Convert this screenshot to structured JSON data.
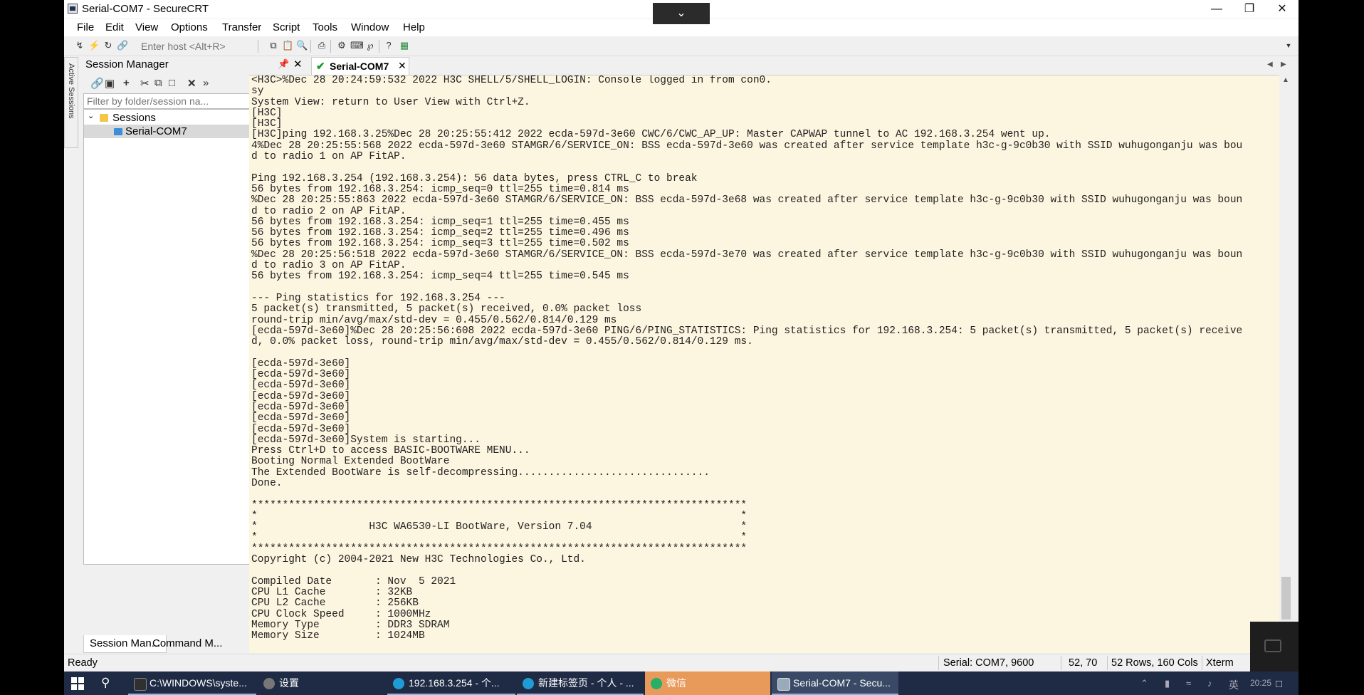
{
  "window": {
    "title": "Serial-COM7 - SecureCRT"
  },
  "menubar": [
    "File",
    "Edit",
    "View",
    "Options",
    "Transfer",
    "Script",
    "Tools",
    "Window",
    "Help"
  ],
  "toolbar": {
    "host_placeholder": "Enter host <Alt+R>"
  },
  "sidebar_tab": "Active Sessions",
  "session_manager": {
    "title": "Session Manager",
    "filter_placeholder": "Filter by folder/session na...",
    "tree": [
      {
        "label": "Sessions",
        "type": "folder",
        "expanded": true
      },
      {
        "label": "Serial-COM7",
        "type": "session",
        "selected": true
      }
    ],
    "bottom_tabs": [
      "Session Man...",
      "Command M..."
    ]
  },
  "session_tab": {
    "label": "Serial-COM7",
    "status": "connected"
  },
  "terminal_text": "<H3C>%Dec 28 20:24:59:532 2022 H3C SHELL/5/SHELL_LOGIN: Console logged in from con0.\nsy\nSystem View: return to User View with Ctrl+Z.\n[H3C]\n[H3C]\n[H3C]ping 192.168.3.25%Dec 28 20:25:55:412 2022 ecda-597d-3e60 CWC/6/CWC_AP_UP: Master CAPWAP tunnel to AC 192.168.3.254 went up.\n4%Dec 28 20:25:55:568 2022 ecda-597d-3e60 STAMGR/6/SERVICE_ON: BSS ecda-597d-3e60 was created after service template h3c-g-9c0b30 with SSID wuhugonganju was bou\nd to radio 1 on AP FitAP.\n\nPing 192.168.3.254 (192.168.3.254): 56 data bytes, press CTRL_C to break\n56 bytes from 192.168.3.254: icmp_seq=0 ttl=255 time=0.814 ms\n%Dec 28 20:25:55:863 2022 ecda-597d-3e60 STAMGR/6/SERVICE_ON: BSS ecda-597d-3e68 was created after service template h3c-g-9c0b30 with SSID wuhugonganju was boun\nd to radio 2 on AP FitAP.\n56 bytes from 192.168.3.254: icmp_seq=1 ttl=255 time=0.455 ms\n56 bytes from 192.168.3.254: icmp_seq=2 ttl=255 time=0.496 ms\n56 bytes from 192.168.3.254: icmp_seq=3 ttl=255 time=0.502 ms\n%Dec 28 20:25:56:518 2022 ecda-597d-3e60 STAMGR/6/SERVICE_ON: BSS ecda-597d-3e70 was created after service template h3c-g-9c0b30 with SSID wuhugonganju was boun\nd to radio 3 on AP FitAP.\n56 bytes from 192.168.3.254: icmp_seq=4 ttl=255 time=0.545 ms\n\n--- Ping statistics for 192.168.3.254 ---\n5 packet(s) transmitted, 5 packet(s) received, 0.0% packet loss\nround-trip min/avg/max/std-dev = 0.455/0.562/0.814/0.129 ms\n[ecda-597d-3e60]%Dec 28 20:25:56:608 2022 ecda-597d-3e60 PING/6/PING_STATISTICS: Ping statistics for 192.168.3.254: 5 packet(s) transmitted, 5 packet(s) receive\nd, 0.0% packet loss, round-trip min/avg/max/std-dev = 0.455/0.562/0.814/0.129 ms.\n\n[ecda-597d-3e60]\n[ecda-597d-3e60]\n[ecda-597d-3e60]\n[ecda-597d-3e60]\n[ecda-597d-3e60]\n[ecda-597d-3e60]\n[ecda-597d-3e60]\n[ecda-597d-3e60]System is starting...\nPress Ctrl+D to access BASIC-BOOTWARE MENU...\nBooting Normal Extended BootWare\nThe Extended BootWare is self-decompressing...............................\nDone.\n\n********************************************************************************\n*                                                                              *\n*                  H3C WA6530-LI BootWare, Version 7.04                        *\n*                                                                              *\n********************************************************************************\nCopyright (c) 2004-2021 New H3C Technologies Co., Ltd.\n\nCompiled Date       : Nov  5 2021\nCPU L1 Cache        : 32KB\nCPU L2 Cache        : 256KB\nCPU Clock Speed     : 1000MHz\nMemory Type         : DDR3 SDRAM\nMemory Size         : 1024MB",
  "statusbar": {
    "state": "Ready",
    "connection": "Serial: COM7, 9600",
    "cursor": "52, 70",
    "size": "52 Rows, 160 Cols",
    "terminal_type": "Xterm"
  },
  "taskbar": {
    "items": [
      {
        "label": "C:\\WINDOWS\\syste...",
        "icon": "cmd-icon",
        "color": "#303030"
      },
      {
        "label": "设置",
        "icon": "gear-icon",
        "color": "#777777"
      },
      {
        "label": "192.168.3.254 - 个...",
        "icon": "edge-icon",
        "color": "#1f9cd6"
      },
      {
        "label": "新建标签页 - 个人 - ...",
        "icon": "edge-icon",
        "color": "#1f9cd6"
      },
      {
        "label": "微信",
        "icon": "wechat-icon",
        "color": "#2aae67"
      },
      {
        "label": "Serial-COM7 - Secu...",
        "icon": "securecrt-icon",
        "color": "#9ab"
      }
    ],
    "tray": {
      "ime": "英",
      "clock": "20:25"
    }
  }
}
